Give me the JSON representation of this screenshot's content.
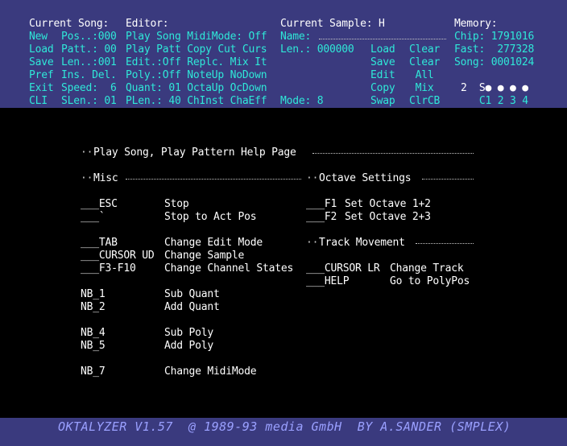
{
  "panel": {
    "headers": {
      "current_song": "Current Song:",
      "editor": "Editor:",
      "current_sample": "Current Sample: H",
      "memory": "Memory:"
    },
    "rows": [
      {
        "btn": "New",
        "field": "Pos..:000",
        "editor": "Play Song MidiMode: Off",
        "sample_label": "Name:",
        "sample_value": "",
        "actions": [
          "",
          ""
        ],
        "memory": "Chip: 1791016"
      },
      {
        "btn": "Load",
        "field": "Patt.: 00",
        "editor": "Play Patt Copy Cut Curs",
        "sample_label": "Len.: 000000",
        "sample_value": "",
        "actions": [
          "Load",
          "Clear"
        ],
        "memory": "Fast:  277328"
      },
      {
        "btn": "Save",
        "field": "Len..:001",
        "editor": "Edit.:Off Replc. Mix It",
        "sample_label": "",
        "sample_value": "",
        "actions": [
          "Save",
          "Clear"
        ],
        "memory": "Song: 0001024"
      },
      {
        "btn": "Pref",
        "field": "Ins. Del.",
        "editor": "Poly.:Off NoteUp NoDown",
        "sample_label": "",
        "sample_value": "",
        "actions": [
          "Edit",
          " All"
        ],
        "memory": ""
      },
      {
        "btn": "Exit",
        "field": "Speed:  6",
        "editor": "Quant: 01 OctaUp OcDown",
        "sample_label": "",
        "sample_value": "",
        "actions": [
          "Copy",
          " Mix"
        ],
        "memory": "2  S● ● ● ●"
      },
      {
        "btn": "CLI",
        "field": "SLen.: 01",
        "editor": "PLen.: 40 ChInst ChaEff",
        "sample_label": "Mode: 8",
        "sample_value": "",
        "actions": [
          "Swap",
          "ClrCB"
        ],
        "memory": "   C1 2 3 4"
      }
    ]
  },
  "help": {
    "title": "Play Song, Play Pattern Help Page",
    "misc_heading": "Misc",
    "octave_heading": "Octave Settings",
    "track_heading": "Track Movement",
    "misc_items": [
      {
        "key": "___ESC",
        "desc": "Stop"
      },
      {
        "key": "___`",
        "desc": "Stop to Act Pos"
      },
      {
        "key": "___TAB",
        "desc": "Change Edit Mode"
      },
      {
        "key": "___CURSOR UD",
        "desc": "Change Sample"
      },
      {
        "key": "___F3-F10",
        "desc": "Change Channel States"
      },
      {
        "key": "NB_1",
        "desc": "Sub Quant"
      },
      {
        "key": "NB_2",
        "desc": "Add Quant"
      },
      {
        "key": "NB_4",
        "desc": "Sub Poly"
      },
      {
        "key": "NB_5",
        "desc": "Add Poly"
      },
      {
        "key": "NB_7",
        "desc": "Change MidiMode"
      }
    ],
    "octave_items": [
      {
        "key": "___F1",
        "desc": "Set Octave 1+2"
      },
      {
        "key": "___F2",
        "desc": "Set Octave 2+3"
      }
    ],
    "track_items": [
      {
        "key": "___CURSOR LR",
        "desc": "Change Track"
      },
      {
        "key": "___HELP",
        "desc": "Go to PolyPos"
      }
    ]
  },
  "footer": "OKTALYZER V1.57  @ 1989-93 media GmbH  BY A.SANDER (SMPLEX)"
}
